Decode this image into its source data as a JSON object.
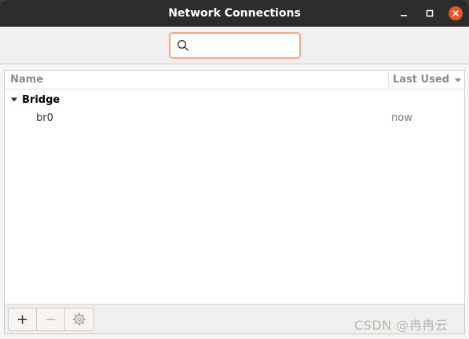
{
  "window": {
    "title": "Network Connections"
  },
  "search": {
    "placeholder": "",
    "value": ""
  },
  "list": {
    "columns": {
      "name": "Name",
      "last_used": "Last Used"
    },
    "groups": [
      {
        "label": "Bridge",
        "connections": [
          {
            "name": "br0",
            "last_used": "now"
          }
        ]
      }
    ]
  },
  "toolbar": {
    "add_label": "+",
    "remove_label": "−"
  },
  "icons": {
    "search": "search-icon",
    "minimize": "minimize-icon",
    "maximize": "maximize-icon",
    "close": "close-icon",
    "expander": "triangle-down-icon",
    "sort": "sort-descending-icon",
    "settings": "gear-icon"
  },
  "colors": {
    "accent": "#e95420",
    "titlebar": "#2c2c2c"
  },
  "watermark": "CSDN @冉冉云"
}
